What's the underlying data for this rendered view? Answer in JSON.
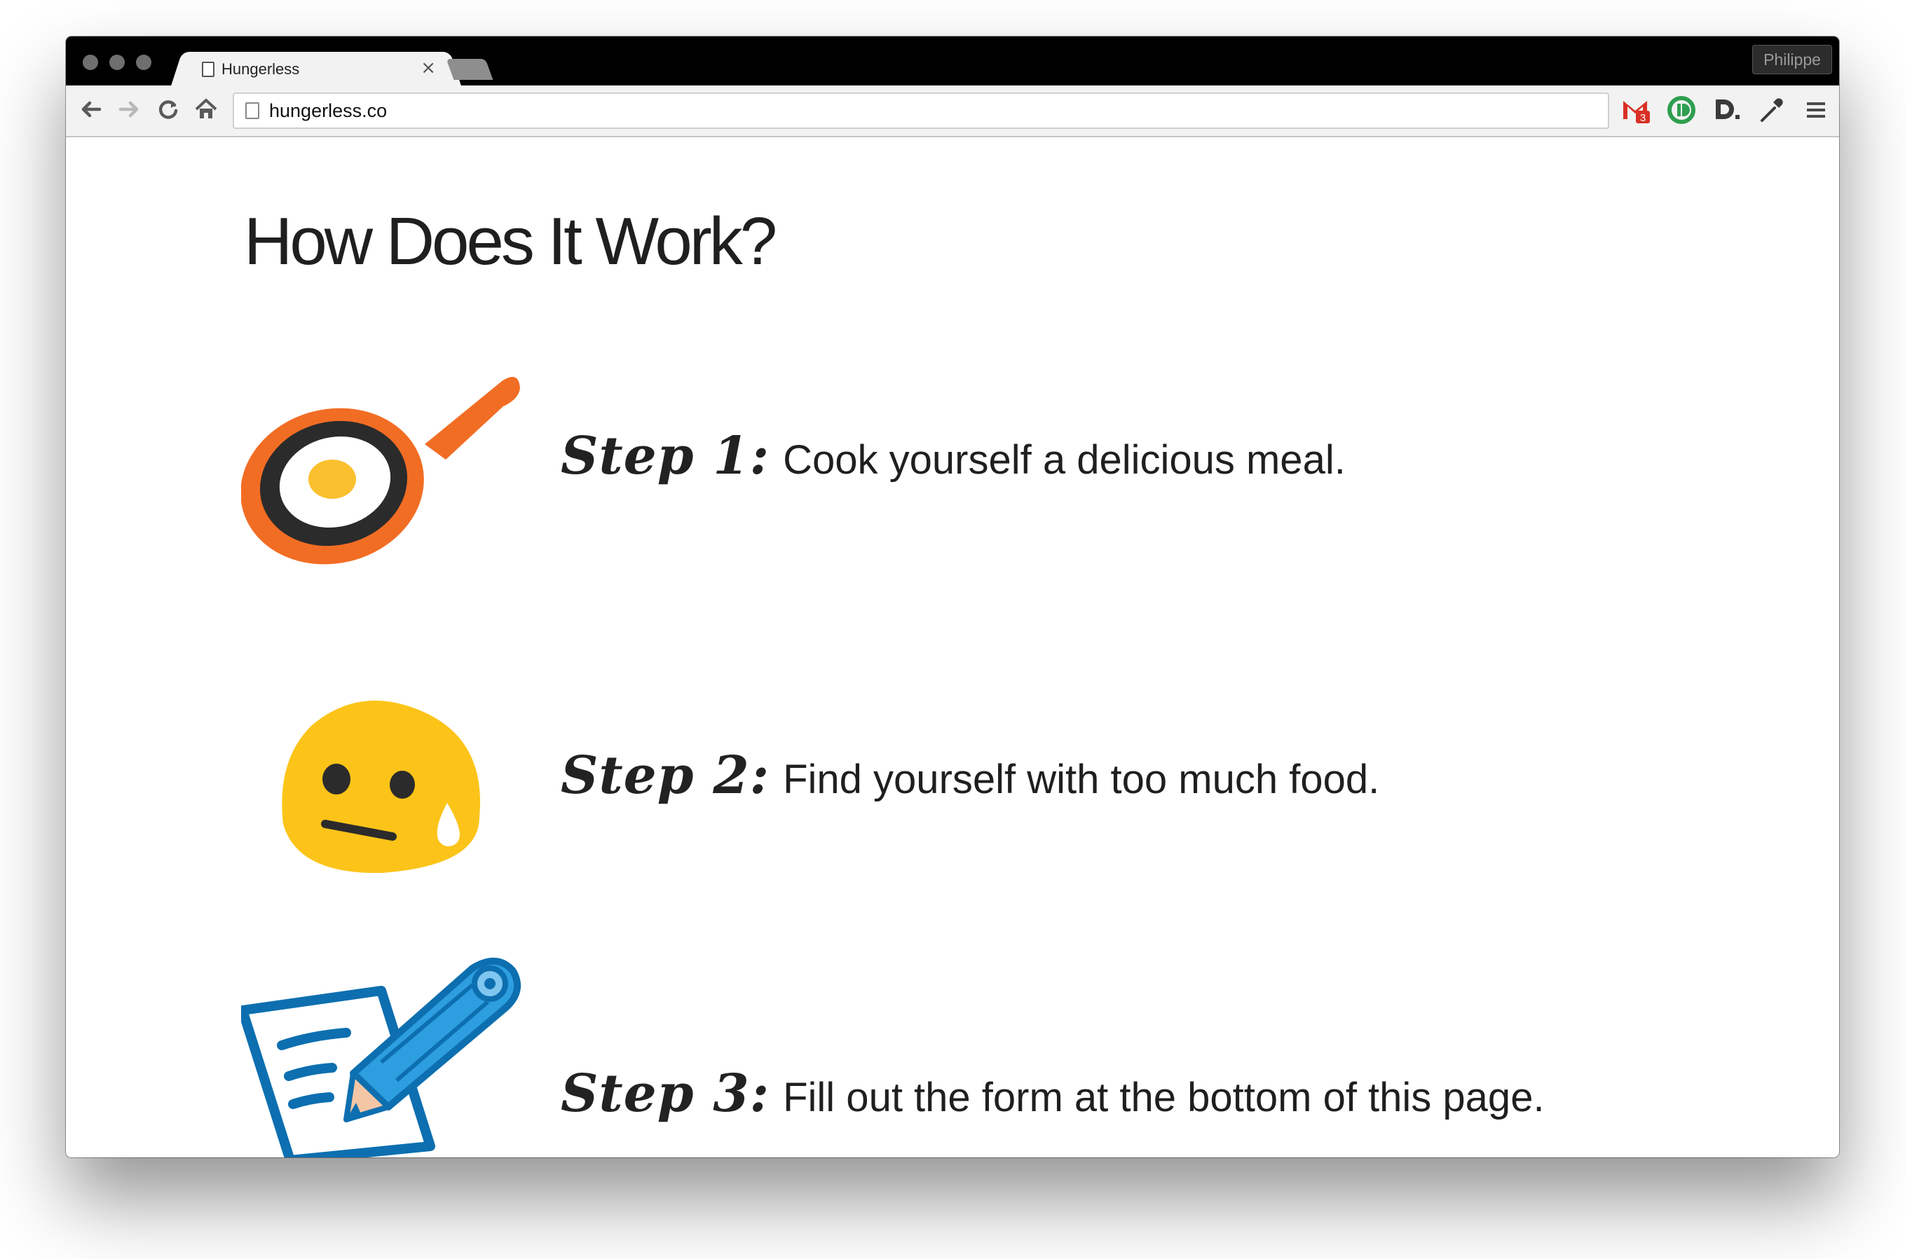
{
  "browser": {
    "tab_title": "Hungerless",
    "tab_close": "×",
    "profile_name": "Philippe",
    "url": "hungerless.co",
    "gmail_badge": "3"
  },
  "icons": {
    "back": "arrow-left",
    "forward": "arrow-right",
    "reload": "reload",
    "home": "home",
    "menu": "hamburger"
  },
  "page": {
    "title": "How Does It Work?",
    "steps": [
      {
        "label": "Step 1:",
        "text": "Cook yourself a delicious meal.",
        "icon": "frying-pan-egg"
      },
      {
        "label": "Step 2:",
        "text": "Find yourself with too much food.",
        "icon": "worried-face"
      },
      {
        "label": "Step 3:",
        "text": "Fill out the form at the bottom of this page.",
        "icon": "pencil-paper"
      }
    ]
  },
  "colors": {
    "pan_orange": "#f26d24",
    "yolk": "#fbc02d",
    "face_yellow": "#fcc419",
    "pencil_blue": "#2d9ee0",
    "paper_outline": "#0d6fb0",
    "gmail_red": "#d93025",
    "ext_green": "#2e9e4f"
  }
}
